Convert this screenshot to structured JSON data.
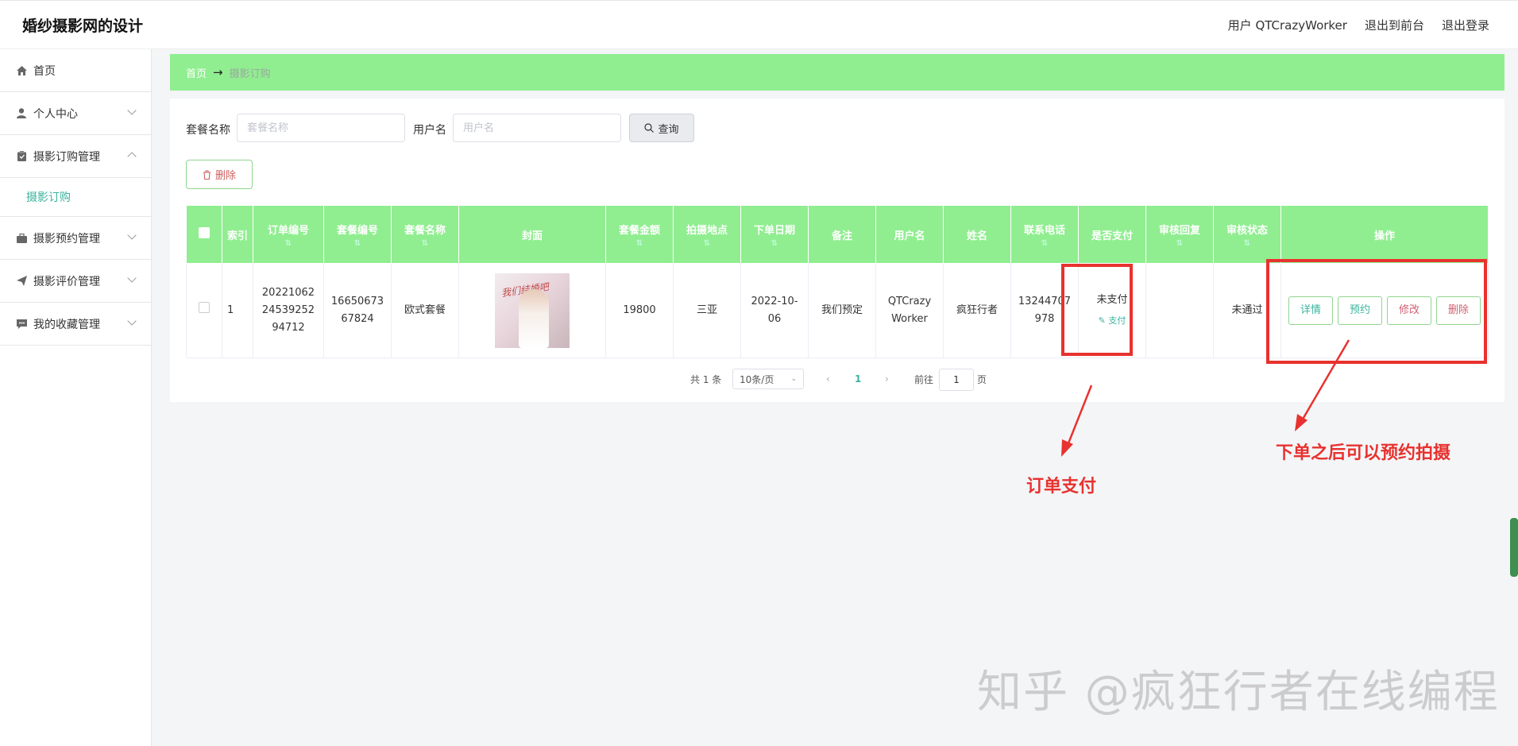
{
  "app_title": "婚纱摄影网的设计",
  "topnav": {
    "user": "用户 QTCrazyWorker",
    "to_front": "退出到前台",
    "logout": "退出登录"
  },
  "sidebar": {
    "items": [
      {
        "label": "首页",
        "icon": "home-icon"
      },
      {
        "label": "个人中心",
        "icon": "user-icon"
      },
      {
        "label": "摄影订购管理",
        "icon": "clipboard-icon"
      },
      {
        "label": "摄影预约管理",
        "icon": "briefcase-icon"
      },
      {
        "label": "摄影评价管理",
        "icon": "send-icon"
      },
      {
        "label": "我的收藏管理",
        "icon": "comment-icon"
      }
    ],
    "sub_active": "摄影订购"
  },
  "breadcrumb": {
    "home": "首页",
    "arrow": "→",
    "current": "摄影订购"
  },
  "search": {
    "package_label": "套餐名称",
    "package_placeholder": "套餐名称",
    "user_label": "用户名",
    "user_placeholder": "用户名",
    "query_button": "查询"
  },
  "delete_button": "删除",
  "table": {
    "headers": [
      "索引",
      "订单编号",
      "套餐编号",
      "套餐名称",
      "封面",
      "套餐金额",
      "拍摄地点",
      "下单日期",
      "备注",
      "用户名",
      "姓名",
      "联系电话",
      "是否支付",
      "审核回复",
      "审核状态",
      "操作"
    ],
    "rows": [
      {
        "index": "1",
        "order_no": "2022106224539252 94712",
        "order_no_lines": [
          "20221062",
          "24539252",
          "94712"
        ],
        "package_no_lines": [
          "16650673",
          "67824"
        ],
        "package_name": "欧式套餐",
        "cover_text": "我们结婚吧",
        "amount": "19800",
        "location": "三亚",
        "date_lines": [
          "2022-10-",
          "06"
        ],
        "remark": "我们预定",
        "username_lines": [
          "QTCrazy",
          "Worker"
        ],
        "name": "疯狂行者",
        "phone_lines": [
          "13244707",
          "978"
        ],
        "paid": "未支付",
        "pay_link": "支付",
        "review_reply": "",
        "review_status": "未通过",
        "actions": [
          "详情",
          "预约",
          "修改",
          "删除"
        ]
      }
    ]
  },
  "pager": {
    "total": "共 1 条",
    "size": "10条/页",
    "page": "1",
    "goto": "前往",
    "goto_value": "1",
    "page_unit": "页"
  },
  "annotations": {
    "pay": "订单支付",
    "book": "下单之后可以预约拍摄"
  },
  "watermark": "知乎 @疯狂行者在线编程",
  "colors": {
    "accent_green": "#90ee90",
    "annot_red": "#e8322f",
    "teal": "#3bb39e"
  }
}
